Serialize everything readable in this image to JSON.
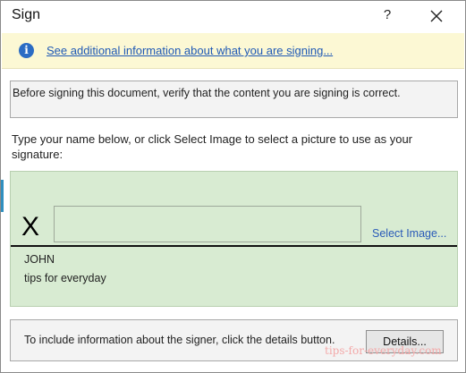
{
  "window": {
    "title": "Sign",
    "help_label": "?"
  },
  "infobar": {
    "icon": "info-icon",
    "icon_glyph": "i",
    "link_text": "See additional information about what you are signing..."
  },
  "verify": {
    "text": "Before signing this document, verify that the content you are signing is correct."
  },
  "instructions": {
    "text": "Type your name below, or click Select Image to select a picture to use as your signature:"
  },
  "signature": {
    "x_mark": "X",
    "input_value": "",
    "select_image_label": "Select Image...",
    "signer_name": "JOHN",
    "signer_title": "tips for everyday"
  },
  "details": {
    "text": "To include information about the signer, click the details button.",
    "button_label": "Details..."
  },
  "watermark": "tips-for-everyday.com",
  "colors": {
    "signature_background": "#d8ebd2",
    "infobar_background": "#fcf8d4",
    "link": "#1f59b5"
  }
}
